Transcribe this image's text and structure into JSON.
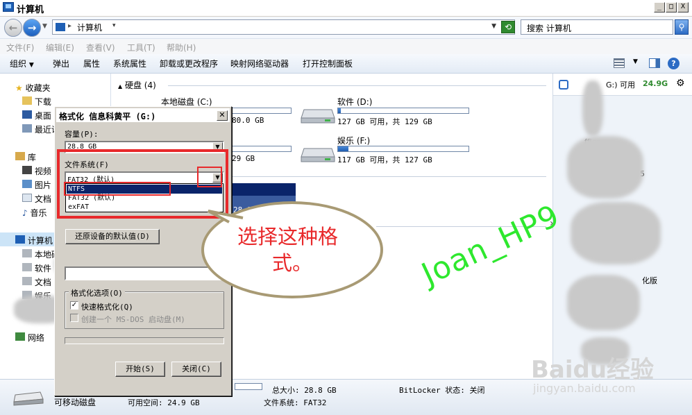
{
  "window": {
    "title": "计算机",
    "controls": [
      "_",
      "□",
      "X"
    ]
  },
  "address": {
    "path": "计算机",
    "search_placeholder": "搜索 计算机"
  },
  "menu": [
    "文件(F)",
    "编辑(E)",
    "查看(V)",
    "工具(T)",
    "帮助(H)"
  ],
  "toolbar": [
    "组织",
    "弹出",
    "属性",
    "系统属性",
    "卸载或更改程序",
    "映射网络驱动器",
    "打开控制面板"
  ],
  "nav": {
    "favorites": "收藏夹",
    "fav_items": [
      "下载",
      "桌面",
      "最近访"
    ],
    "libraries": "库",
    "lib_items": [
      "视频",
      "图片",
      "文档",
      "音乐"
    ],
    "computer": "计算机",
    "comp_items": [
      "本地磁",
      "软件",
      "文档",
      "娱乐"
    ],
    "network": "网络"
  },
  "content": {
    "group_hdd": "硬盘 (4)",
    "drives": [
      {
        "name": "本地磁盘 (C:)",
        "info": "80.0 GB",
        "used_fraction": 0.55
      },
      {
        "name": "软件 (D:)",
        "info": "127 GB 可用，共 129 GB",
        "used_fraction": 0.02
      },
      {
        "name": "",
        "info": "29 GB",
        "used_fraction": 0.2
      },
      {
        "name": "娱乐 (F:)",
        "info": "117 GB 可用，共 127 GB",
        "used_fraction": 0.08
      }
    ],
    "removable_info": "28.8 GB"
  },
  "preview": {
    "header_text": "G:) 可用",
    "free": "24.9G",
    "items": [
      "ffice",
      "5",
      "化版"
    ]
  },
  "details": {
    "name": "可移动磁盘",
    "free": "可用空间: 24.9 GB",
    "total": "总大小: 28.8 GB",
    "fs": "文件系统: FAT32",
    "bitlocker": "BitLocker 状态: 关闭"
  },
  "dialog": {
    "title": "格式化 信息科黄平 (G:)",
    "capacity_label": "容量(P):",
    "capacity_value": "28.8 GB",
    "fs_label": "文件系统(F)",
    "fs_value": "FAT32 (默认)",
    "fs_options": [
      "NTFS",
      "FAT32 (默认)",
      "exFAT"
    ],
    "restore_button": "还原设备的默认值(D)",
    "options_label": "格式化选项(O)",
    "quick_format": "快速格式化(Q)",
    "msdos": "创建一个 MS-DOS 启动盘(M)",
    "start_button": "开始(S)",
    "close_button": "关闭(C)"
  },
  "annotation": {
    "bubble_line1": "选择这种格",
    "bubble_line2": "式。",
    "watermark": "Joan_HP9",
    "logo": "Baidu经验",
    "logo_url": "jingyan.baidu.com"
  }
}
